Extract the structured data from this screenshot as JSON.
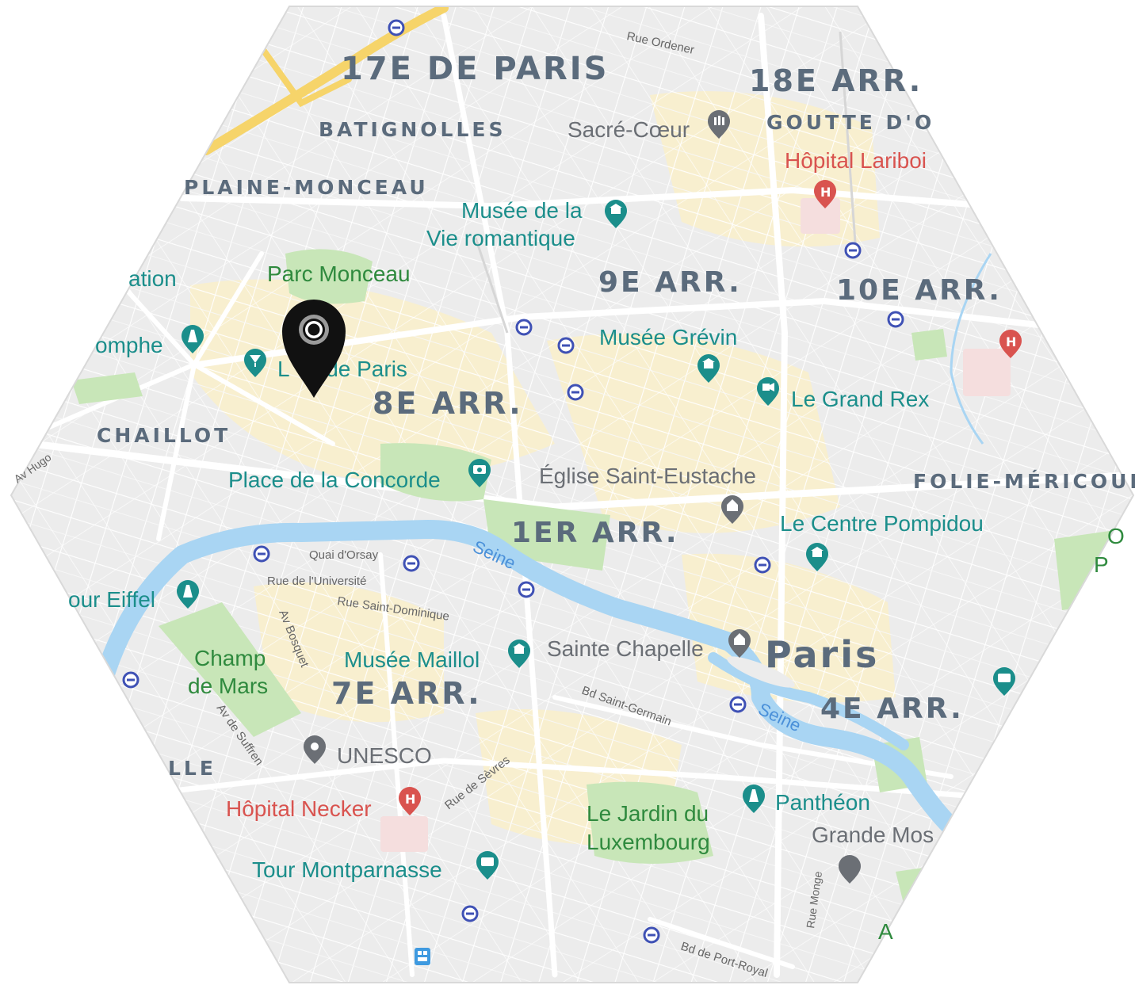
{
  "colors": {
    "background": "#ffffff",
    "land": "#ececec",
    "road": "#ffffff",
    "major_road": "#f6d46a",
    "water": "#a9d5f3",
    "park": "#c8e6b8",
    "urban_area": "#f8efcf",
    "district_text": "#5b6b7c",
    "poi_teal": "#1b8e8b",
    "poi_green": "#2f8a3e",
    "poi_gray": "#6b6f75",
    "poi_red": "#d9534f",
    "water_label": "#4a90d9",
    "street_text": "#666666",
    "marker": "#111111",
    "metro_icon": "#3f51b5"
  },
  "districts": [
    {
      "id": "17e",
      "label": "17E DE PARIS"
    },
    {
      "id": "18e",
      "label": "18E ARR."
    },
    {
      "id": "9e",
      "label": "9E ARR."
    },
    {
      "id": "10e",
      "label": "10E ARR."
    },
    {
      "id": "8e",
      "label": "8E ARR."
    },
    {
      "id": "1er",
      "label": "1ER ARR."
    },
    {
      "id": "7e",
      "label": "7E ARR."
    },
    {
      "id": "4e",
      "label": "4E ARR."
    },
    {
      "id": "paris",
      "label": "Paris"
    }
  ],
  "neighborhoods": [
    {
      "id": "batignolles",
      "label": "BATIGNOLLES"
    },
    {
      "id": "goutte",
      "label": "GOUTTE D'O"
    },
    {
      "id": "plaine",
      "label": "PLAINE-MONCEAU"
    },
    {
      "id": "chaillot",
      "label": "CHAILLOT"
    },
    {
      "id": "folie",
      "label": "FOLIE-MÉRICOUR"
    },
    {
      "id": "lle",
      "label": "LLE"
    }
  ],
  "pois": [
    {
      "id": "sacre-coeur",
      "label": "Sacré-Cœur",
      "icon": "landmark-icon"
    },
    {
      "id": "hopital-lariboisiere",
      "label": "Hôpital Lariboi",
      "icon": "hospital-icon"
    },
    {
      "id": "musee-vie-romantique-1",
      "label": "Musée de la",
      "icon": "museum-icon"
    },
    {
      "id": "musee-vie-romantique-2",
      "label": "Vie romantique",
      "icon": ""
    },
    {
      "id": "parc-monceau",
      "label": "Parc Monceau",
      "icon": ""
    },
    {
      "id": "station-partial",
      "label": "ation",
      "icon": ""
    },
    {
      "id": "arc-triomphe",
      "label": "omphe",
      "icon": "monument-icon"
    },
    {
      "id": "lido",
      "label": "L      de Paris",
      "icon": "nightlife-icon"
    },
    {
      "id": "musee-grevin",
      "label": "Musée Grévin",
      "icon": "museum-icon"
    },
    {
      "id": "grand-rex",
      "label": "Le Grand Rex",
      "icon": "cinema-icon"
    },
    {
      "id": "place-concorde",
      "label": "Place de la Concorde",
      "icon": "attraction-icon"
    },
    {
      "id": "eglise-saint-eustache",
      "label": "Église Saint-Eustache",
      "icon": "church-icon"
    },
    {
      "id": "centre-pompidou",
      "label": "Le Centre Pompidou",
      "icon": "museum-icon"
    },
    {
      "id": "tour-eiffel",
      "label": "our Eiffel",
      "icon": "monument-icon"
    },
    {
      "id": "champ-mars-1",
      "label": "Champ",
      "icon": ""
    },
    {
      "id": "champ-mars-2",
      "label": "de Mars",
      "icon": ""
    },
    {
      "id": "musee-maillol",
      "label": "Musée Maillol",
      "icon": "museum-icon"
    },
    {
      "id": "sainte-chapelle",
      "label": "Sainte Chapelle",
      "icon": "church-icon"
    },
    {
      "id": "unesco",
      "label": "UNESCO",
      "icon": "pin-icon"
    },
    {
      "id": "hopital-necker",
      "label": "Hôpital Necker",
      "icon": "hospital-icon"
    },
    {
      "id": "jardin-lux-1",
      "label": "Le Jardin du",
      "icon": ""
    },
    {
      "id": "jardin-lux-2",
      "label": "Luxembourg",
      "icon": ""
    },
    {
      "id": "pantheon",
      "label": "Panthéon",
      "icon": "monument-icon"
    },
    {
      "id": "grande-mosquee",
      "label": "Grande Mos",
      "icon": "mosque-icon"
    },
    {
      "id": "tour-montparnasse",
      "label": "Tour Montparnasse",
      "icon": "attraction-icon"
    }
  ],
  "streets": [
    {
      "id": "rue-ordener",
      "label": "Rue Ordener"
    },
    {
      "id": "quai-orsay",
      "label": "Quai d'Orsay"
    },
    {
      "id": "rue-universite",
      "label": "Rue de l'Université"
    },
    {
      "id": "rue-saint-dominique",
      "label": "Rue Saint-Dominique"
    },
    {
      "id": "av-bosquet",
      "label": "Av Bosquet"
    },
    {
      "id": "av-suffren",
      "label": "Av de Suffren"
    },
    {
      "id": "rue-sevres",
      "label": "Rue de Sèvres"
    },
    {
      "id": "bd-saint-germain",
      "label": "Bd Saint-Germain"
    },
    {
      "id": "bd-port-royal",
      "label": "Bd de Port-Royal"
    },
    {
      "id": "rue-monge",
      "label": "Rue Monge"
    },
    {
      "id": "av-hugo",
      "label": "Av Hugo"
    }
  ],
  "water_labels": [
    {
      "id": "seine-1",
      "label": "Seine"
    },
    {
      "id": "seine-2",
      "label": "Seine"
    }
  ],
  "edge_fragments": [
    {
      "id": "frag-o",
      "label": "O"
    },
    {
      "id": "frag-p",
      "label": "P"
    },
    {
      "id": "frag-a",
      "label": "A"
    }
  ],
  "marker": {
    "icon": "map-pin-icon"
  }
}
